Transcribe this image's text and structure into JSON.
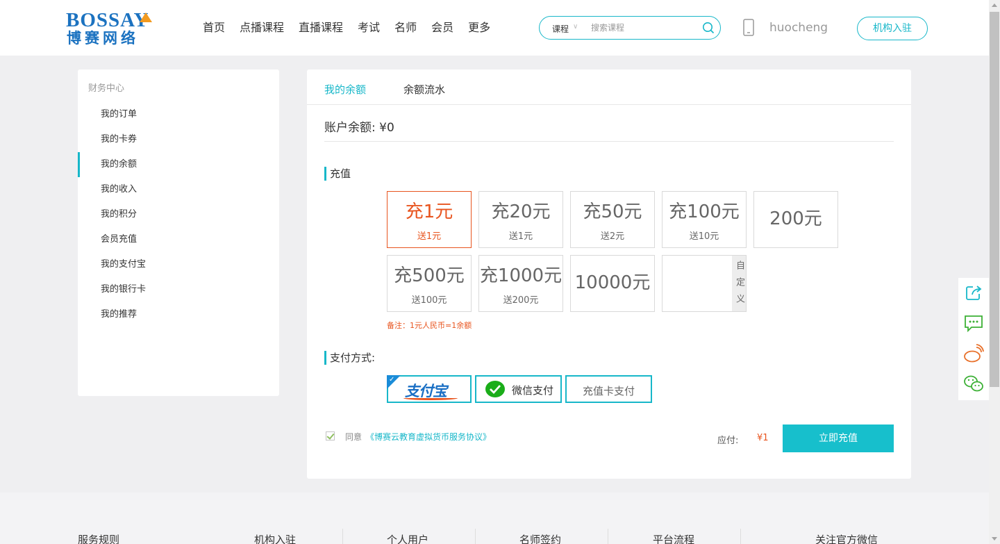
{
  "header": {
    "logo_en": "BOSSAY",
    "logo_cn": "博赛网络",
    "nav": [
      "首页",
      "点播课程",
      "直播课程",
      "考试",
      "名师",
      "会员",
      "更多"
    ],
    "search": {
      "category": "课程",
      "placeholder": "搜索课程"
    },
    "username": "huocheng",
    "join_label": "机构入驻"
  },
  "sidebar": {
    "title": "财务中心",
    "items": [
      "我的订单",
      "我的卡券",
      "我的余额",
      "我的收入",
      "我的积分",
      "会员充值",
      "我的支付宝",
      "我的银行卡",
      "我的推荐"
    ],
    "active_item": "我的余额"
  },
  "main": {
    "tabs": [
      "我的余额",
      "余额流水"
    ],
    "active_tab": "我的余额",
    "balance_text": "账户余额:  ¥0",
    "recharge_title": "充值",
    "amounts": [
      {
        "main": "充1元",
        "bonus": "送1元",
        "selected": true
      },
      {
        "main": "充20元",
        "bonus": "送1元"
      },
      {
        "main": "充50元",
        "bonus": "送2元"
      },
      {
        "main": "充100元",
        "bonus": "送10元"
      },
      {
        "main": "200元",
        "bonus": ""
      },
      {
        "main": "充500元",
        "bonus": "送100元"
      },
      {
        "main": "充1000元",
        "bonus": "送200元"
      },
      {
        "main": "10000元",
        "bonus": ""
      }
    ],
    "custom_label": "自定义",
    "note": "备注：1元人民币=1余额",
    "payment_title": "支付方式:",
    "payments": {
      "alipay": "支付宝",
      "wechat": "微信支付",
      "card": "充值卡支付"
    },
    "selected_payment": "alipay",
    "agree_text": "同意",
    "agree_link": "《博赛云教育虚拟货币服务协议》",
    "due_label": "应付:",
    "due_value": "¥1",
    "submit_label": "立即充值"
  },
  "floatbar": [
    "share-icon",
    "message-icon",
    "weibo-icon",
    "wechat-icon"
  ],
  "footer": {
    "columns": [
      "服务规则",
      "机构入驻",
      "个人用户",
      "名师签约",
      "平台流程",
      "关注官方微信"
    ]
  },
  "colors": {
    "accent": "#17b7c9",
    "selected": "#e8541e",
    "brand": "#1b72c0"
  }
}
